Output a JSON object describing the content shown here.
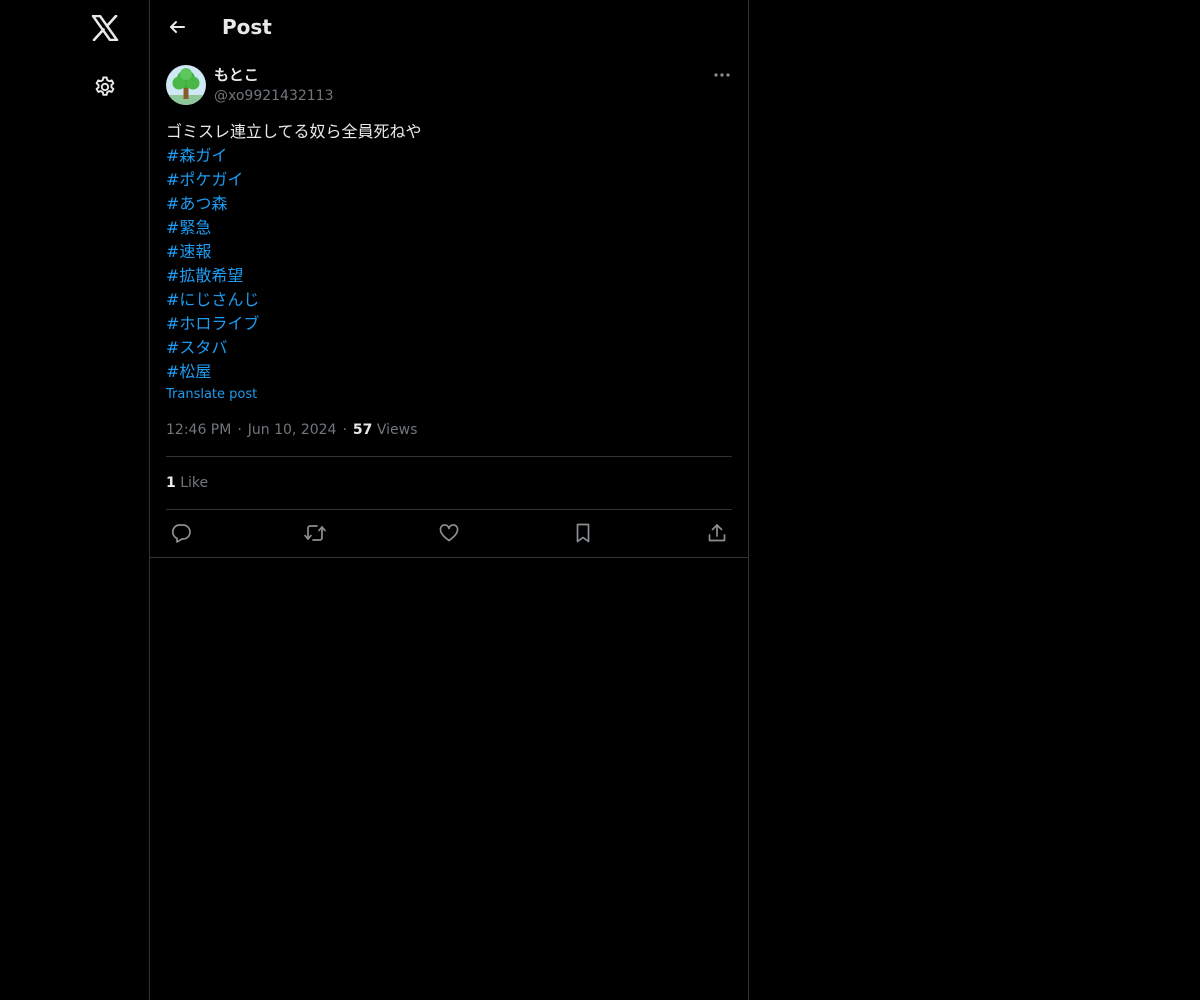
{
  "header": {
    "title": "Post"
  },
  "post": {
    "display_name": "もとこ",
    "handle": "@xo9921432113",
    "text": "ゴミスレ連立してる奴ら全員死ねや",
    "hashtags": [
      "#森ガイ",
      "#ポケガイ",
      "#あつ森",
      "#緊急",
      "#速報",
      "#拡散希望",
      "#にじさんじ",
      "#ホロライブ",
      "#スタバ",
      "#松屋"
    ],
    "translate_label": "Translate post",
    "time": "12:46 PM",
    "date": "Jun 10, 2024",
    "separator": "·",
    "views_count": "57",
    "views_label": "Views",
    "likes_count": "1",
    "likes_label": "Like"
  },
  "icons": {
    "nav": [
      "x-logo-icon",
      "gear-icon"
    ],
    "header": [
      "back-arrow-icon"
    ],
    "post": [
      "more-icon"
    ],
    "actions": [
      "reply-icon",
      "repost-icon",
      "like-icon",
      "bookmark-icon",
      "share-icon"
    ]
  },
  "colors": {
    "background": "#000000",
    "text_primary": "#e7e9ea",
    "text_secondary": "#71767b",
    "accent": "#1d9bf0",
    "border": "#2f3336"
  }
}
